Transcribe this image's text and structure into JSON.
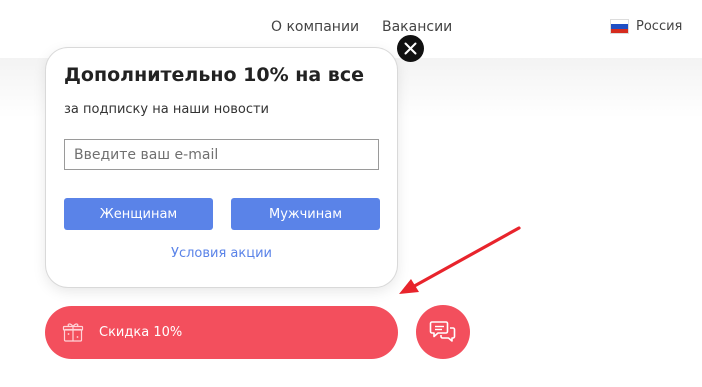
{
  "header": {
    "nav": {
      "about_label": "О компании",
      "jobs_label": "Вакансии"
    },
    "language": {
      "label": "Россия",
      "flag_icon": "russia-flag-icon"
    }
  },
  "popup": {
    "title": "Дополнительно 10% на все",
    "subtitle": "за подписку на наши новости",
    "email_placeholder": "Введите ваш e-mail",
    "women_button": "Женщинам",
    "men_button": "Мужчинам",
    "terms_link": "Условия акции",
    "close_icon": "close-icon"
  },
  "promo_bar": {
    "label": "Скидка 10%",
    "icon": "gift-icon"
  },
  "chat": {
    "icon": "chat-bubbles-icon"
  },
  "annotation": {
    "icon": "red-arrow-icon",
    "color": "#e8242c"
  },
  "colors": {
    "accent_red": "#f34f5d",
    "button_blue": "#5a83e8",
    "link_blue": "#5a83e8",
    "close_bg": "#111111"
  }
}
